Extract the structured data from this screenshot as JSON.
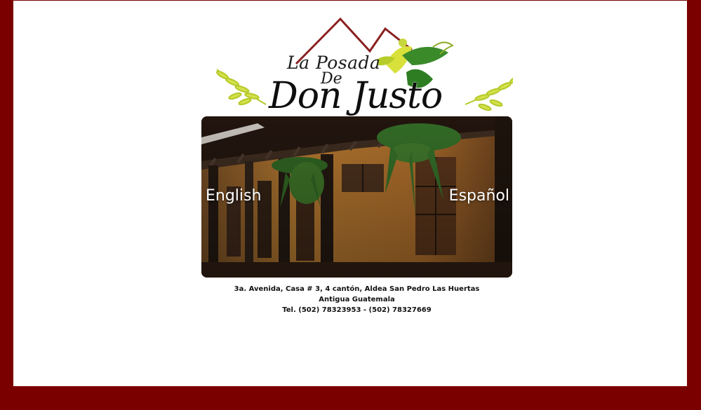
{
  "logo": {
    "line1": "La Posada",
    "line2": "De",
    "line3": "Don Justo"
  },
  "languages": {
    "english": "English",
    "spanish": "Español"
  },
  "footer": {
    "address": "3a. Avenida, Casa # 3, 4 cantón, Aldea San Pedro Las Huertas",
    "city": "Antigua Guatemala",
    "phone": "Tel. (502) 78323953 - (502) 78327669"
  },
  "colors": {
    "frame": "#7a0000",
    "page": "#ffffff",
    "mountain": "#8a1f1f",
    "leaf_light": "#c7d63a",
    "leaf_dark": "#3a8a2a"
  }
}
